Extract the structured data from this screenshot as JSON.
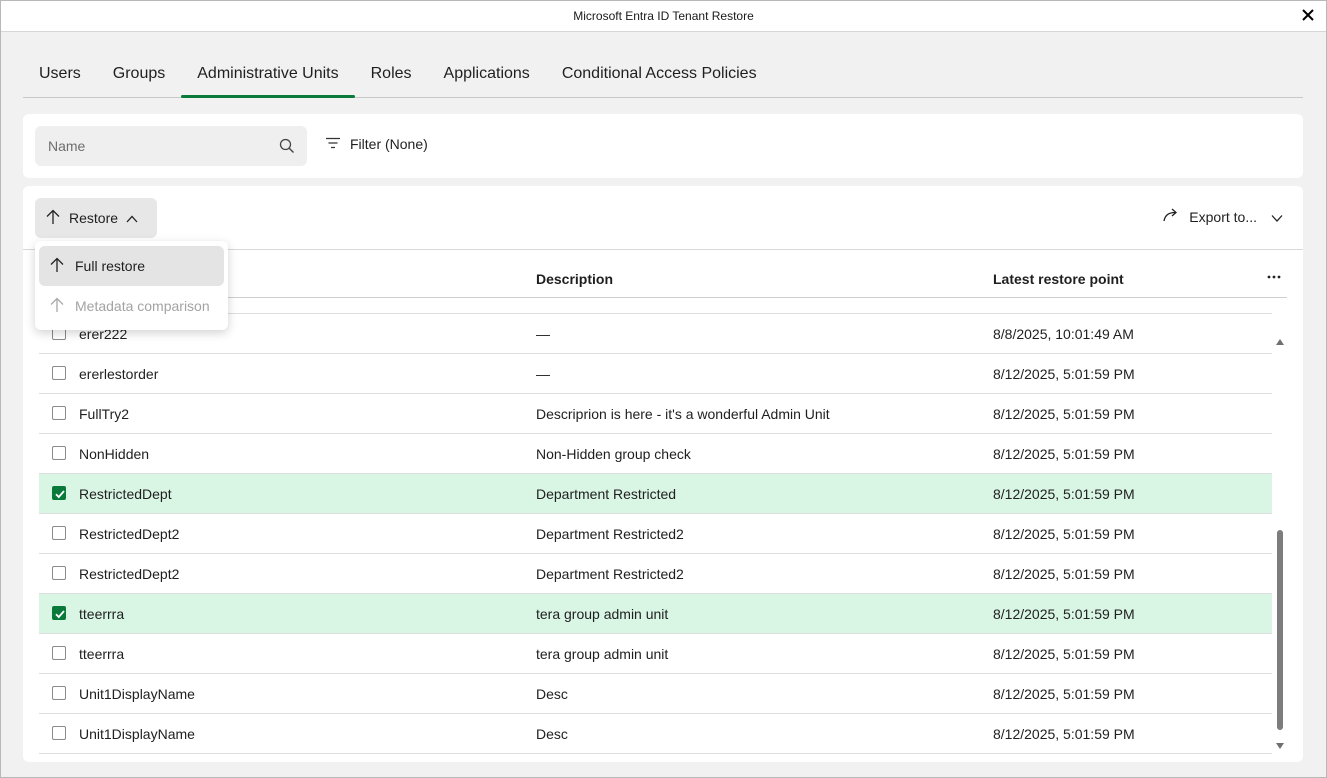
{
  "window": {
    "title": "Microsoft Entra ID Tenant Restore"
  },
  "tabs": [
    {
      "label": "Users"
    },
    {
      "label": "Groups"
    },
    {
      "label": "Administrative Units",
      "active": true
    },
    {
      "label": "Roles"
    },
    {
      "label": "Applications"
    },
    {
      "label": "Conditional Access Policies"
    }
  ],
  "search": {
    "placeholder": "Name",
    "value": ""
  },
  "filter": {
    "label": "Filter (None)"
  },
  "toolbar": {
    "restore_label": "Restore",
    "export_label": "Export to..."
  },
  "restore_menu": {
    "items": [
      {
        "label": "Full restore",
        "enabled": true
      },
      {
        "label": "Metadata comparison",
        "enabled": false
      }
    ]
  },
  "table": {
    "columns": {
      "name": "",
      "description": "Description",
      "latest_restore_point": "Latest restore point"
    },
    "rows": [
      {
        "name": "",
        "description": "",
        "date": "",
        "selected": false,
        "partial": true
      },
      {
        "name": "erer222",
        "description": "—",
        "date": "8/8/2025, 10:01:49 AM",
        "selected": false
      },
      {
        "name": "ererlestorder",
        "description": "—",
        "date": "8/12/2025, 5:01:59 PM",
        "selected": false
      },
      {
        "name": "FullTry2",
        "description": "Descriprion is here - it's a wonderful Admin Unit",
        "date": "8/12/2025, 5:01:59 PM",
        "selected": false
      },
      {
        "name": "NonHidden",
        "description": "Non-Hidden group check",
        "date": "8/12/2025, 5:01:59 PM",
        "selected": false
      },
      {
        "name": "RestrictedDept",
        "description": "Department Restricted",
        "date": "8/12/2025, 5:01:59 PM",
        "selected": true
      },
      {
        "name": "RestrictedDept2",
        "description": "Department Restricted2",
        "date": "8/12/2025, 5:01:59 PM",
        "selected": false
      },
      {
        "name": "RestrictedDept2",
        "description": "Department Restricted2",
        "date": "8/12/2025, 5:01:59 PM",
        "selected": false
      },
      {
        "name": "tteerrra",
        "description": "tera group admin unit",
        "date": "8/12/2025, 5:01:59 PM",
        "selected": true
      },
      {
        "name": "tteerrra",
        "description": "tera group admin unit",
        "date": "8/12/2025, 5:01:59 PM",
        "selected": false
      },
      {
        "name": "Unit1DisplayName",
        "description": "Desc",
        "date": "8/12/2025, 5:01:59 PM",
        "selected": false
      },
      {
        "name": "Unit1DisplayName",
        "description": "Desc",
        "date": "8/12/2025, 5:01:59 PM",
        "selected": false
      }
    ]
  },
  "colors": {
    "accent": "#0a7a3b",
    "selected_row": "#d9f6e4",
    "page_bg": "#f1f1f1"
  },
  "icons": {
    "close": "close-icon",
    "search": "search-icon",
    "filter": "filter-icon",
    "restore": "arrow-up-icon",
    "restore_toggle": "chevron-up-icon",
    "export": "share-arrow-icon",
    "export_toggle": "chevron-down-icon",
    "more": "more-horizontal-icon",
    "checkbox_checked": "checkmark-icon"
  }
}
